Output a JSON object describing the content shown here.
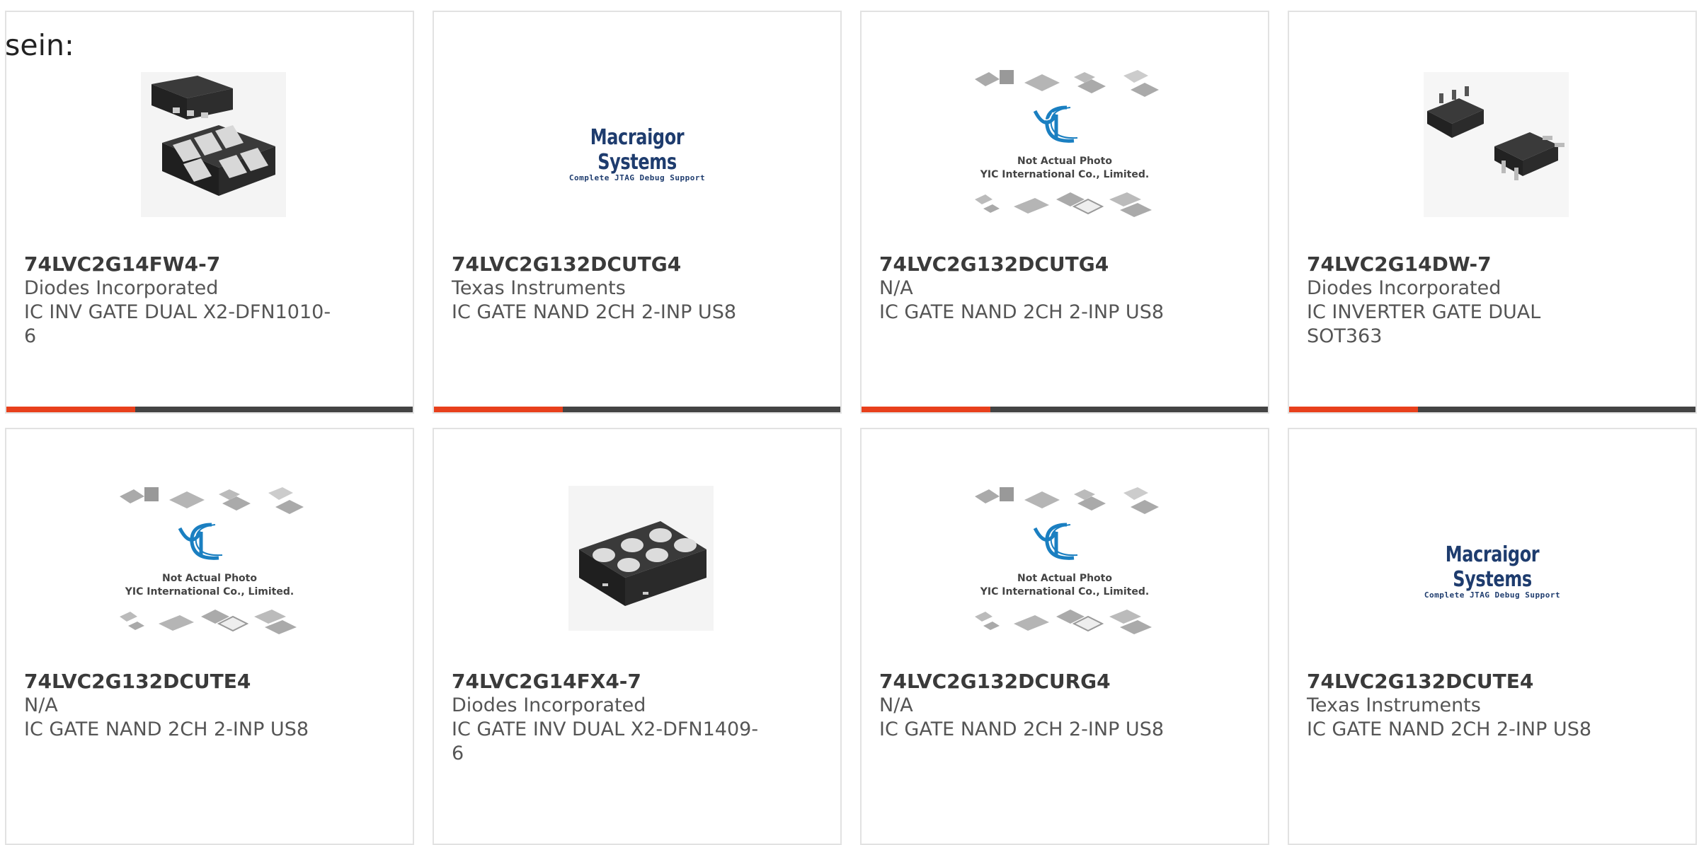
{
  "intro_text": "sein:",
  "colors": {
    "accent": "#e8401c",
    "bar": "#444444"
  },
  "products": [
    {
      "part_number": "74LVC2G14FW4-7",
      "manufacturer": "Diodes Incorporated",
      "description": "IC INV GATE DUAL X2-DFN1010-6",
      "image": "dfn6-chip-photo"
    },
    {
      "part_number": "74LVC2G132DCUTG4",
      "manufacturer": "Texas Instruments",
      "description": "IC GATE NAND 2CH 2-INP US8",
      "image": "macraigor-logo",
      "logo_title": "Macraigor Systems",
      "logo_subtitle": "Complete JTAG Debug Support"
    },
    {
      "part_number": "74LVC2G132DCUTG4",
      "manufacturer": "N/A",
      "description": "IC GATE NAND 2CH 2-INP US8",
      "image": "yic-placeholder",
      "placeholder_line1": "Not Actual Photo",
      "placeholder_line2": "YIC International Co., Limited."
    },
    {
      "part_number": "74LVC2G14DW-7",
      "manufacturer": "Diodes Incorporated",
      "description": "IC INVERTER GATE DUAL SOT363",
      "image": "sot363-chip-photo"
    },
    {
      "part_number": "74LVC2G132DCUTE4",
      "manufacturer": "N/A",
      "description": "IC GATE NAND 2CH 2-INP US8",
      "image": "yic-placeholder",
      "placeholder_line1": "Not Actual Photo",
      "placeholder_line2": "YIC International Co., Limited."
    },
    {
      "part_number": "74LVC2G14FX4-7",
      "manufacturer": "Diodes Incorporated",
      "description": "IC GATE INV DUAL X2-DFN1409-6",
      "image": "dfn1409-chip-photo"
    },
    {
      "part_number": "74LVC2G132DCURG4",
      "manufacturer": "N/A",
      "description": "IC GATE NAND 2CH 2-INP US8",
      "image": "yic-placeholder",
      "placeholder_line1": "Not Actual Photo",
      "placeholder_line2": "YIC International Co., Limited."
    },
    {
      "part_number": "74LVC2G132DCUTE4",
      "manufacturer": "Texas Instruments",
      "description": "IC GATE NAND 2CH 2-INP US8",
      "image": "macraigor-logo",
      "logo_title": "Macraigor Systems",
      "logo_subtitle": "Complete JTAG Debug Support"
    }
  ]
}
